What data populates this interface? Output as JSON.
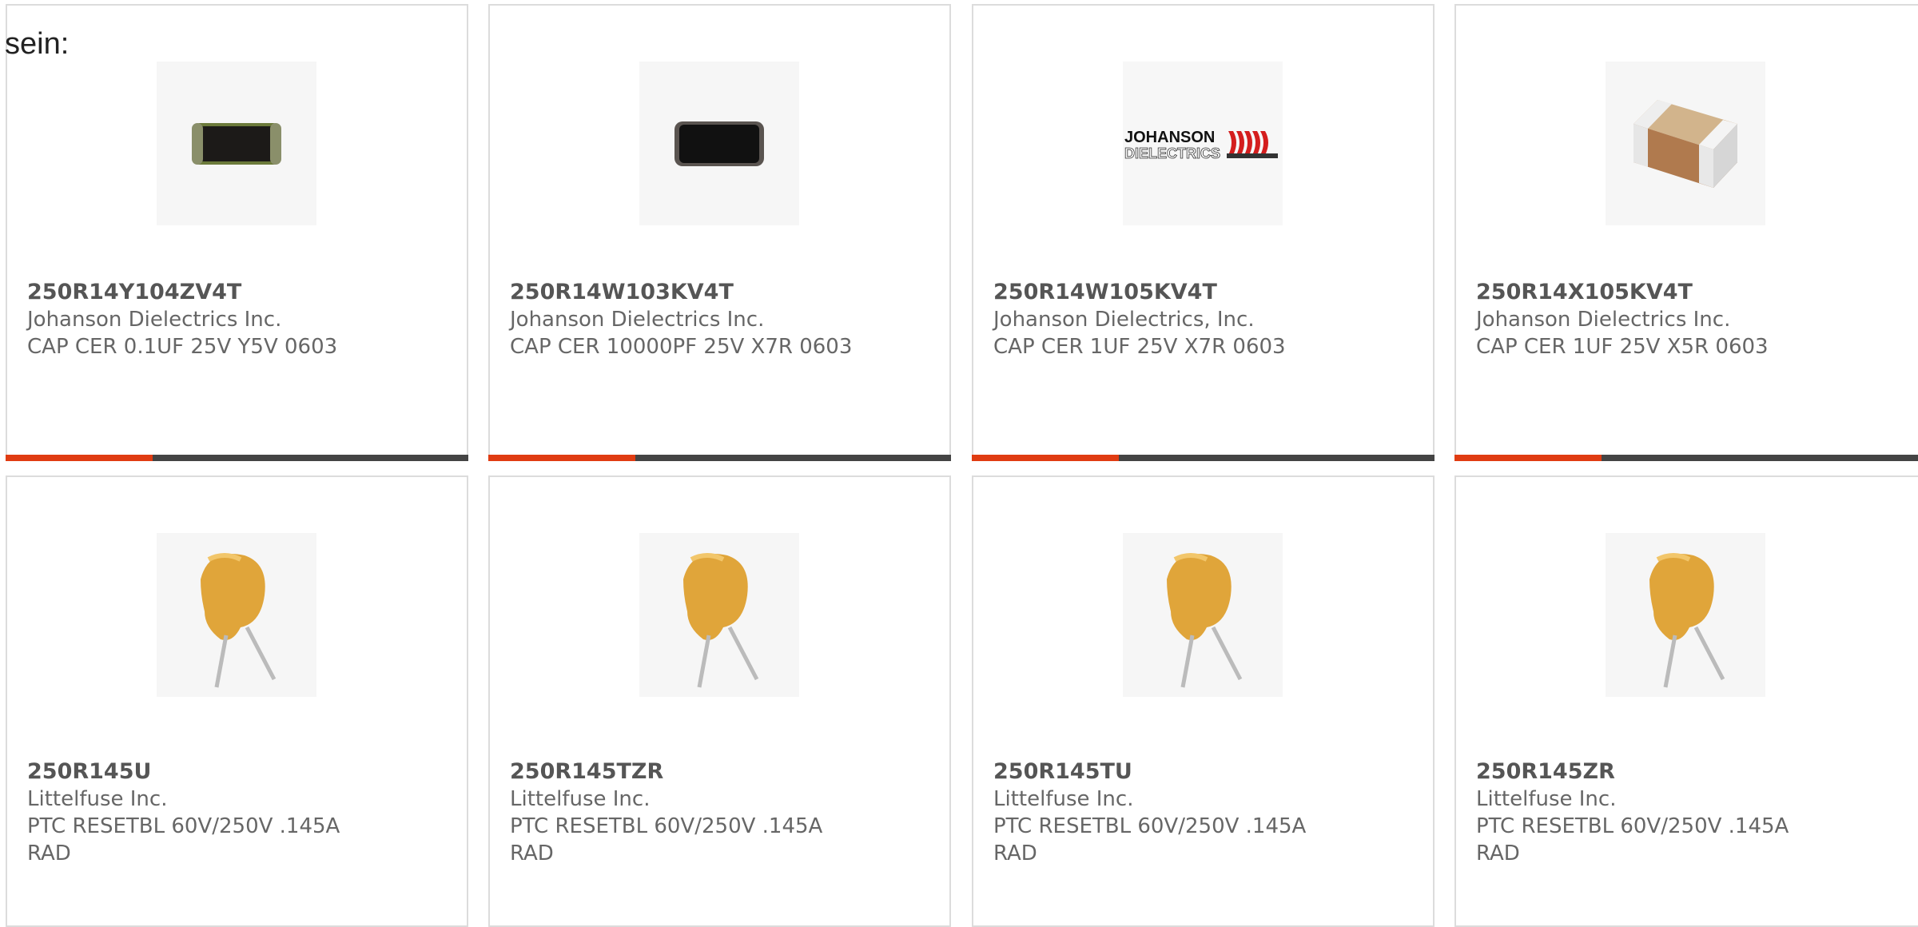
{
  "intro_text": "sein:",
  "products": [
    {
      "part_number": "250R14Y104ZV4T",
      "manufacturer": "Johanson Dielectrics Inc.",
      "description": "CAP CER 0.1UF 25V Y5V 0603",
      "image": "smd-capacitor-dark-icon"
    },
    {
      "part_number": "250R14W103KV4T",
      "manufacturer": "Johanson Dielectrics Inc.",
      "description": "CAP CER 10000PF 25V X7R 0603",
      "image": "smd-capacitor-dark-icon"
    },
    {
      "part_number": "250R14W105KV4T",
      "manufacturer": "Johanson Dielectrics, Inc.",
      "description": "CAP CER 1UF 25V X7R 0603",
      "image": "johanson-dielectrics-logo",
      "logo_line1": "JOHANSON",
      "logo_line2": "DIELECTRICS"
    },
    {
      "part_number": "250R14X105KV4T",
      "manufacturer": "Johanson Dielectrics Inc.",
      "description": "CAP CER 1UF 25V X5R 0603",
      "image": "smd-capacitor-tan-icon"
    },
    {
      "part_number": "250R145U",
      "manufacturer": "Littelfuse Inc.",
      "description": "PTC RESETBL 60V/250V .145A",
      "description2": "RAD",
      "image": "radial-ptc-fuse-icon"
    },
    {
      "part_number": "250R145TZR",
      "manufacturer": "Littelfuse Inc.",
      "description": "PTC RESETBL 60V/250V .145A",
      "description2": "RAD",
      "image": "radial-ptc-fuse-icon"
    },
    {
      "part_number": "250R145TU",
      "manufacturer": "Littelfuse Inc.",
      "description": "PTC RESETBL 60V/250V .145A",
      "description2": "RAD",
      "image": "radial-ptc-fuse-icon"
    },
    {
      "part_number": "250R145ZR",
      "manufacturer": "Littelfuse Inc.",
      "description": "PTC RESETBL 60V/250V .145A",
      "description2": "RAD",
      "image": "radial-ptc-fuse-icon"
    }
  ],
  "colors": {
    "accent": "#e03c12",
    "bar": "#444444",
    "border": "#dcdcdc",
    "text": "#666666"
  }
}
